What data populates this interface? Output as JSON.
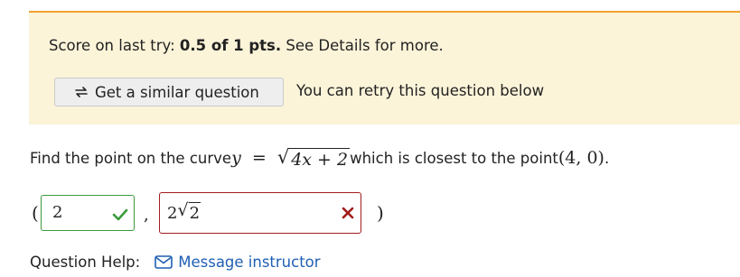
{
  "score_panel": {
    "prefix": "Score on last try: ",
    "score": "0.5 of 1 pts.",
    "suffix": " See Details for more.",
    "similar_button_label": "Get a similar question",
    "retry_text": "You can retry this question below"
  },
  "question": {
    "lead_text": "Find the point on the curve ",
    "var_y": "y",
    "equals": "=",
    "radicand": "4x + 2",
    "middle_text": " which is closest to the point ",
    "point": "(4, 0)",
    "end": "."
  },
  "answer": {
    "open_paren": "(",
    "comma": ",",
    "close_paren": ")",
    "x_value": "2",
    "x_status": "correct",
    "y_coefficient": "2",
    "y_radicand": "2",
    "y_status": "incorrect"
  },
  "help": {
    "label": "Question Help:",
    "message_link": "Message instructor",
    "message_icon": "mail-icon"
  },
  "colors": {
    "panel_background": "#fcf4d9",
    "panel_top_border": "#f0a030",
    "correct": "#3a9b3a",
    "incorrect": "#a11d1d",
    "link": "#1e5fb3"
  }
}
